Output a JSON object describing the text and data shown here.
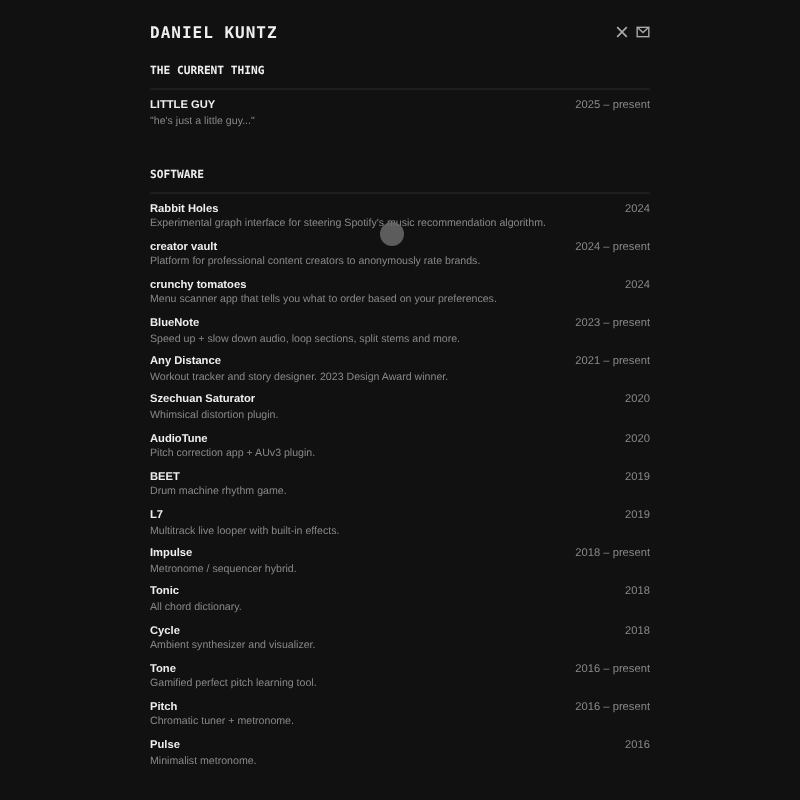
{
  "header": {
    "name": "DANIEL KUNTZ"
  },
  "sections": [
    {
      "title": "THE CURRENT THING",
      "items": [
        {
          "name": "LITTLE GUY",
          "description": "\"he's just a little guy...\"",
          "years": "2025 – present"
        }
      ]
    },
    {
      "title": "SOFTWARE",
      "items": [
        {
          "name": "Rabbit Holes",
          "description": "Experimental graph interface for steering Spotify's music recommendation algorithm.",
          "years": "2024"
        },
        {
          "name": "creator vault",
          "description": "Platform for professional content creators to anonymously rate brands.",
          "years": "2024 – present"
        },
        {
          "name": "crunchy tomatoes",
          "description": "Menu scanner app that tells you what to order based on your preferences.",
          "years": "2024"
        },
        {
          "name": "BlueNote",
          "description": "Speed up + slow down audio, loop sections, split stems and more.",
          "years": "2023 – present"
        },
        {
          "name": "Any Distance",
          "description": "Workout tracker and story designer. 2023  Design Award winner.",
          "years": "2021 – present"
        },
        {
          "name": "Szechuan Saturator",
          "description": "Whimsical distortion plugin.",
          "years": "2020"
        },
        {
          "name": "AudioTune",
          "description": "Pitch correction app + AUv3 plugin.",
          "years": "2020"
        },
        {
          "name": "BEET",
          "description": "Drum machine rhythm game.",
          "years": "2019"
        },
        {
          "name": "L7",
          "description": "Multitrack live looper with built-in effects.",
          "years": "2019"
        },
        {
          "name": "Impulse",
          "description": "Metronome / sequencer hybrid.",
          "years": "2018 – present"
        },
        {
          "name": "Tonic",
          "description": "All chord dictionary.",
          "years": "2018"
        },
        {
          "name": "Cycle",
          "description": "Ambient synthesizer and visualizer.",
          "years": "2018"
        },
        {
          "name": "Tone",
          "description": "Gamified perfect pitch learning tool.",
          "years": "2016 – present"
        },
        {
          "name": "Pitch",
          "description": "Chromatic tuner + metronome.",
          "years": "2016 – present"
        },
        {
          "name": "Pulse",
          "description": "Minimalist metronome.",
          "years": "2016"
        }
      ]
    }
  ]
}
